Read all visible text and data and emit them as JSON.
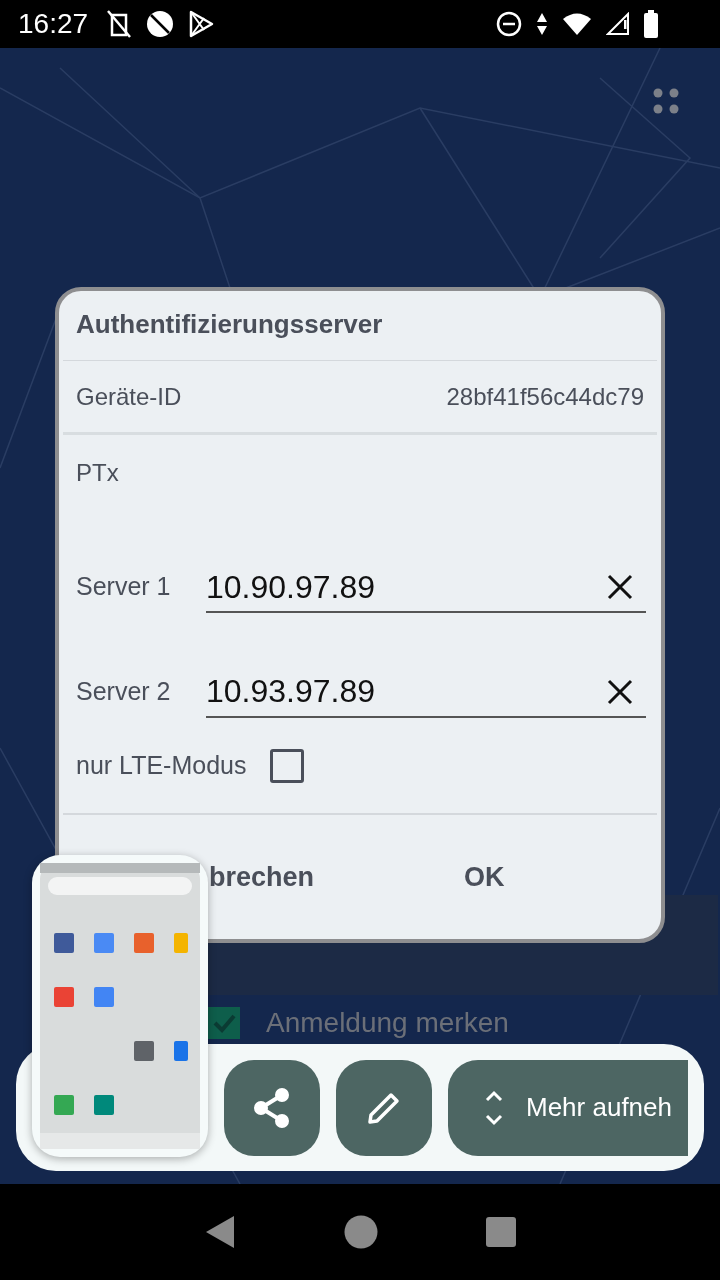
{
  "status_bar": {
    "time": "16:27"
  },
  "background": {
    "remember": {
      "label": "Anmeldung merken",
      "checked": true
    }
  },
  "dialog": {
    "title": "Authentifizierungsserver",
    "device_id": {
      "label": "Geräte-ID",
      "value": "28bf41f56c44dc79"
    },
    "section": "PTx",
    "servers": [
      {
        "label": "Server 1",
        "value": "10.90.97.89"
      },
      {
        "label": "Server 2",
        "value": "10.93.97.89"
      }
    ],
    "lte_only": {
      "label": "nur LTE-Modus",
      "checked": false
    },
    "buttons": [
      "brechen",
      "OK"
    ]
  },
  "toolbar": {
    "buttons": [
      {
        "kind": "share"
      },
      {
        "kind": "edit"
      },
      {
        "kind": "expand",
        "label": "Mehr aufneh"
      }
    ]
  }
}
